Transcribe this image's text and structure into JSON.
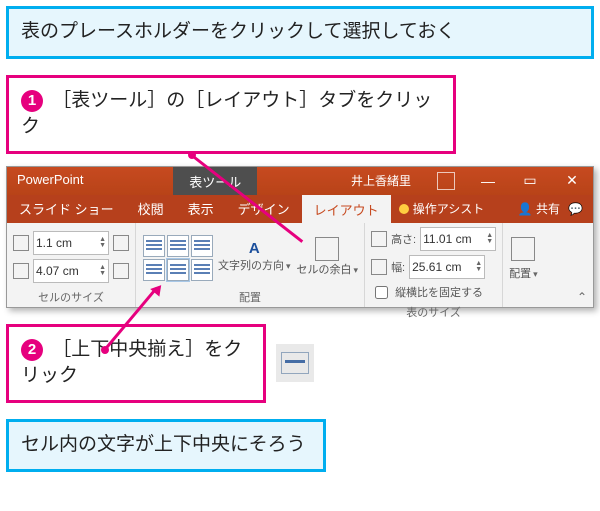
{
  "callouts": {
    "pre": "表のプレースホルダーをクリックして選択しておく",
    "step1": "［表ツール］の［レイアウト］タブをクリック",
    "step2": "［上下中央揃え］をクリック",
    "result": "セル内の文字が上下中央にそろう",
    "num1": "1",
    "num2": "2"
  },
  "titlebar": {
    "app": "PowerPoint",
    "contextual": "表ツール",
    "user": "井上香緒里",
    "btn_restore": "❐",
    "btn_min": "—",
    "btn_band": "▭",
    "btn_close": "✕"
  },
  "tabs": {
    "slideshow": "スライド ショー",
    "review": "校閲",
    "view": "表示",
    "design": "デザイン",
    "layout": "レイアウト",
    "assist": "操作アシスト",
    "share": "共有"
  },
  "ribbon": {
    "cellsize": {
      "h_label": "",
      "w_label": "",
      "h": "1.1 cm",
      "w": "4.07 cm",
      "group": "セルのサイズ"
    },
    "align": {
      "textdir": "文字列の方向",
      "cellmargin": "セルの余白",
      "group": "配置"
    },
    "tablesize": {
      "h_label": "高さ:",
      "w_label": "幅:",
      "h": "11.01 cm",
      "w": "25.61 cm",
      "lock": "縦横比を固定する",
      "group": "表のサイズ"
    },
    "arrange": {
      "label": "配置"
    }
  }
}
